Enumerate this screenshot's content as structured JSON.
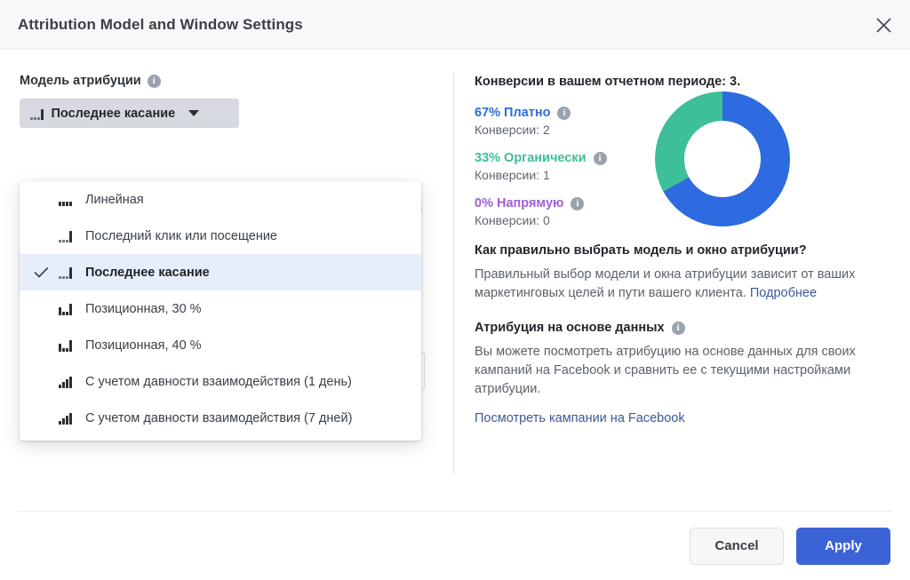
{
  "header": {
    "title": "Attribution Model and Window Settings",
    "close_icon": "close-icon"
  },
  "left": {
    "field_label": "Модель атрибуции",
    "info_icon": "info-icon",
    "select": {
      "value": "Последнее касание",
      "glyph": "last-touch-bars-icon",
      "caret_icon": "chevron-down-icon"
    },
    "dropdown": {
      "items": [
        {
          "label": "Линейная",
          "glyph": "linear-bars-icon",
          "selected": false
        },
        {
          "label": "Последний клик или посещение",
          "glyph": "last-click-bars-icon",
          "selected": false
        },
        {
          "label": "Последнее касание",
          "glyph": "last-touch-bars-icon",
          "selected": true
        },
        {
          "label": "Позиционная, 30 %",
          "glyph": "position-bars-icon",
          "selected": false
        },
        {
          "label": "Позиционная, 40 %",
          "glyph": "position-bars-icon",
          "selected": false
        },
        {
          "label": "С учетом давности взаимодействия (1 день)",
          "glyph": "time-decay-bars-icon",
          "selected": false
        },
        {
          "label": "С учетом давности взаимодействия (7 дней)",
          "glyph": "time-decay-bars-icon",
          "selected": false
        }
      ],
      "check_icon": "check-icon"
    }
  },
  "right": {
    "title": "Конверсии в вашем отчетном периоде: 3.",
    "legend": [
      {
        "name": "67% Платно",
        "sub": "Конверсии: 2",
        "color": "#2e6ae0",
        "info_icon": "info-icon"
      },
      {
        "name": "33% Органически",
        "sub": "Конверсии: 1",
        "color": "#3dbf9a",
        "info_icon": "info-icon"
      },
      {
        "name": "0% Напрямую",
        "sub": "Конверсии: 0",
        "color": "#a05ed4",
        "info_icon": "info-icon"
      }
    ],
    "how_to": {
      "heading": "Как правильно выбрать модель и окно атрибуции?",
      "body": "Правильный выбор модели и окна атрибуции зависит от ваших маркетинговых целей и пути вашего клиента.",
      "link": "Подробнее"
    },
    "data_driven": {
      "heading": "Атрибуция на основе данных",
      "info_icon": "info-icon",
      "body": "Вы можете посмотреть атрибуцию на основе данных для своих кампаний на Facebook и сравнить ее с текущими настройками атрибуции.",
      "link": "Посмотреть кампании на Facebook"
    }
  },
  "footer": {
    "cancel_label": "Cancel",
    "apply_label": "Apply"
  },
  "chart_data": {
    "type": "pie",
    "title": "Конверсии в вашем отчетном периоде: 3.",
    "categories": [
      "Платно",
      "Органически",
      "Напрямую"
    ],
    "values": [
      2,
      1,
      0
    ],
    "percentages": [
      67,
      33,
      0
    ],
    "colors": [
      "#2e6ae0",
      "#3dbf9a",
      "#a05ed4"
    ],
    "total": 3,
    "donut": true,
    "legend_position": "left"
  }
}
